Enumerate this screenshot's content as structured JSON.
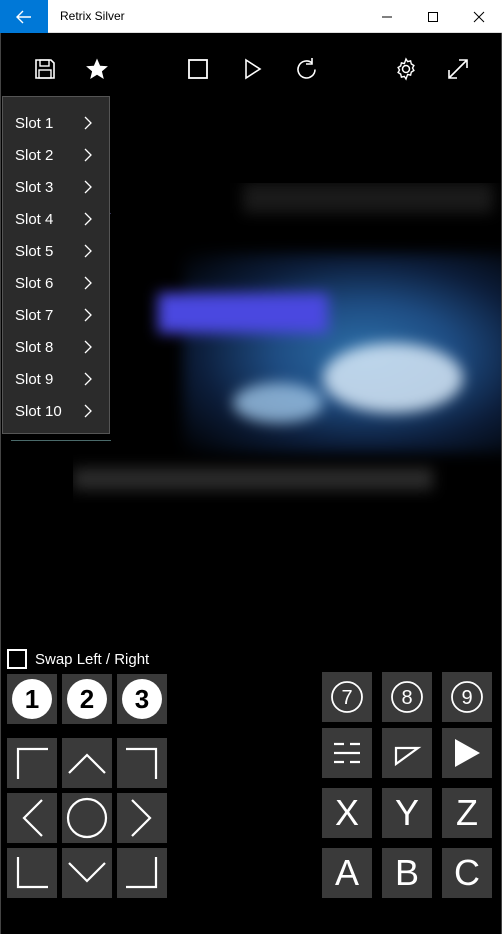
{
  "window": {
    "title": "Retrix Silver",
    "buttons": [
      "back-arrow-icon",
      "minimize-icon",
      "maximize-icon",
      "close-icon"
    ]
  },
  "toolbar": {
    "left": [
      "save-icon",
      "star-icon"
    ],
    "center": [
      "stop-icon",
      "play-icon",
      "reset-icon"
    ],
    "right": [
      "settings-icon",
      "fullscreen-icon"
    ]
  },
  "slot_menu": {
    "items": [
      {
        "label": "Slot 1"
      },
      {
        "label": "Slot 2"
      },
      {
        "label": "Slot 3"
      },
      {
        "label": "Slot 4"
      },
      {
        "label": "Slot 5"
      },
      {
        "label": "Slot 6"
      },
      {
        "label": "Slot 7"
      },
      {
        "label": "Slot 8"
      },
      {
        "label": "Slot 9"
      },
      {
        "label": "Slot 10"
      }
    ]
  },
  "controls": {
    "swap_label": "Swap Left / Right",
    "swap_checked": false,
    "left_top_buttons": [
      "1",
      "2",
      "3"
    ],
    "right_number_buttons": [
      "7",
      "8",
      "9"
    ],
    "right_mid_buttons": [
      "mode-icon",
      "select-icon",
      "start-icon"
    ],
    "xyz": [
      "X",
      "Y",
      "Z"
    ],
    "abc": [
      "A",
      "B",
      "C"
    ]
  },
  "colors": {
    "accent": "#0078d7",
    "button_bg": "#3a3a3a",
    "menu_bg": "#2b2b2b"
  }
}
